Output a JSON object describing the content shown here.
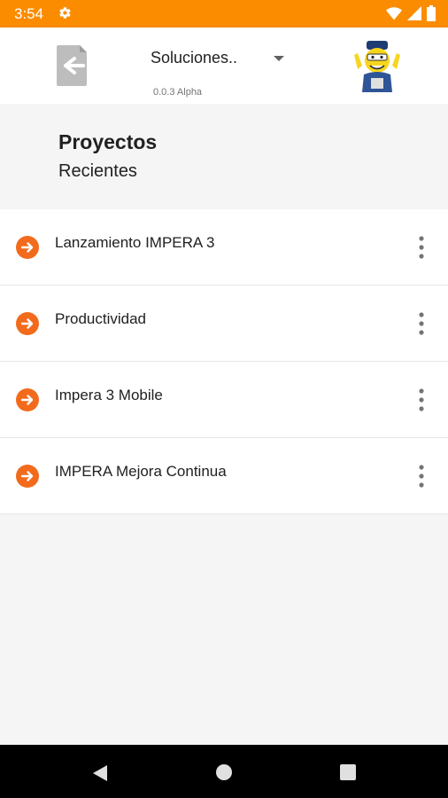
{
  "status_bar": {
    "time": "3:54",
    "color": "#fb8c00"
  },
  "app_bar": {
    "title": "Soluciones..",
    "version": "0.0.3 Alpha"
  },
  "section": {
    "title": "Proyectos",
    "subtitle": "Recientes"
  },
  "projects": [
    {
      "label": "Lanzamiento IMPERA 3"
    },
    {
      "label": "Productividad"
    },
    {
      "label": "Impera 3 Mobile"
    },
    {
      "label": "IMPERA Mejora Continua"
    }
  ],
  "icons": {
    "item": "arrow-circle-right-icon",
    "menu": "more-vertical-icon",
    "back": "exit-to-app-icon"
  },
  "accent_color": "#f26b1d"
}
